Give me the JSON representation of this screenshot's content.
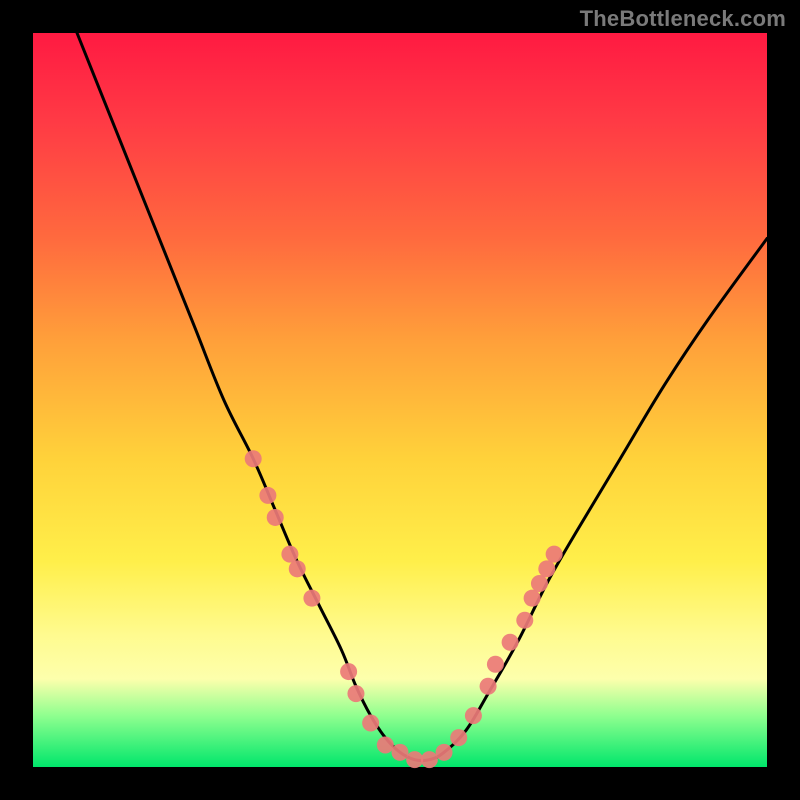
{
  "watermark": "TheBottleneck.com",
  "chart_data": {
    "type": "line",
    "title": "",
    "xlabel": "",
    "ylabel": "",
    "xlim": [
      0,
      100
    ],
    "ylim": [
      0,
      100
    ],
    "grid": false,
    "series": [
      {
        "name": "bottleneck-curve",
        "color": "#000000",
        "x": [
          6,
          10,
          14,
          18,
          22,
          26,
          30,
          33,
          36,
          39,
          42,
          44,
          46,
          48,
          50,
          52,
          54,
          56,
          59,
          62,
          66,
          70,
          74,
          80,
          86,
          92,
          100
        ],
        "values": [
          100,
          90,
          80,
          70,
          60,
          50,
          42,
          35,
          28,
          22,
          16,
          11,
          7,
          4,
          2,
          1,
          1,
          2,
          5,
          10,
          17,
          25,
          32,
          42,
          52,
          61,
          72
        ]
      }
    ],
    "markers": {
      "name": "highlighted-points",
      "color": "#eb7a78",
      "points": [
        {
          "x": 30,
          "y": 42
        },
        {
          "x": 32,
          "y": 37
        },
        {
          "x": 33,
          "y": 34
        },
        {
          "x": 35,
          "y": 29
        },
        {
          "x": 36,
          "y": 27
        },
        {
          "x": 38,
          "y": 23
        },
        {
          "x": 43,
          "y": 13
        },
        {
          "x": 44,
          "y": 10
        },
        {
          "x": 46,
          "y": 6
        },
        {
          "x": 48,
          "y": 3
        },
        {
          "x": 50,
          "y": 2
        },
        {
          "x": 52,
          "y": 1
        },
        {
          "x": 54,
          "y": 1
        },
        {
          "x": 56,
          "y": 2
        },
        {
          "x": 58,
          "y": 4
        },
        {
          "x": 60,
          "y": 7
        },
        {
          "x": 62,
          "y": 11
        },
        {
          "x": 63,
          "y": 14
        },
        {
          "x": 65,
          "y": 17
        },
        {
          "x": 67,
          "y": 20
        },
        {
          "x": 68,
          "y": 23
        },
        {
          "x": 69,
          "y": 25
        },
        {
          "x": 70,
          "y": 27
        },
        {
          "x": 71,
          "y": 29
        }
      ]
    }
  }
}
